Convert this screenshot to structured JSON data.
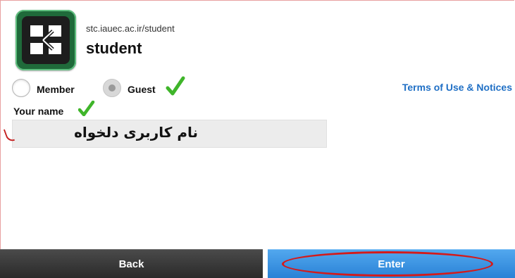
{
  "header": {
    "url": "stc.iauec.ac.ir/student",
    "title": "student"
  },
  "login_type": {
    "member_label": "Member",
    "guest_label": "Guest",
    "selected": "Guest"
  },
  "terms_link": "Terms of Use & Notices",
  "name_field": {
    "label": "Your name",
    "value": "نام کاربری دلخواه"
  },
  "buttons": {
    "back": "Back",
    "enter": "Enter"
  },
  "colors": {
    "link": "#1f6fc5",
    "enter_button": "#2a82d6",
    "back_button": "#333333",
    "annotation": "#d41a1a",
    "check": "#3fb52a"
  }
}
